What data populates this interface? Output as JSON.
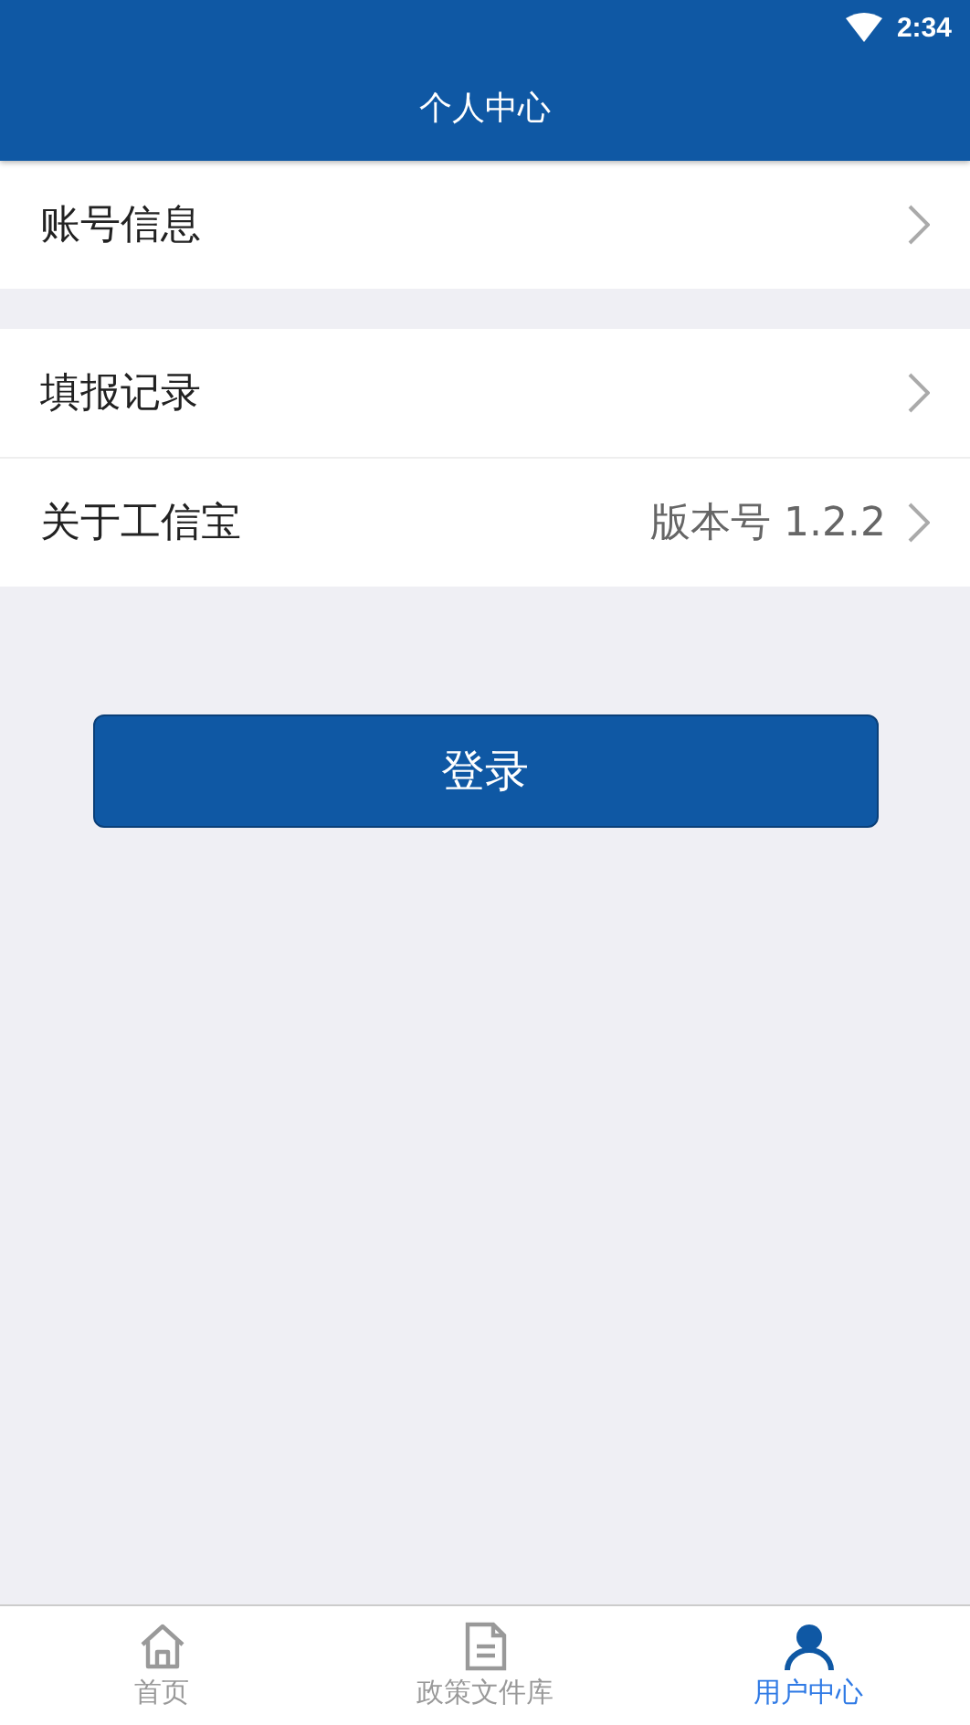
{
  "status_bar": {
    "time": "2:34"
  },
  "header": {
    "title": "个人中心"
  },
  "groups": [
    [
      {
        "label": "账号信息"
      }
    ],
    [
      {
        "label": "填报记录"
      },
      {
        "label": "关于工信宝",
        "value": "版本号 1.2.2"
      }
    ]
  ],
  "login_button": "登录",
  "tabs": [
    {
      "label": "首页",
      "kind": "home",
      "selected": false
    },
    {
      "label": "政策文件库",
      "kind": "document",
      "selected": false
    },
    {
      "label": "用户中心",
      "kind": "user",
      "selected": true
    }
  ]
}
